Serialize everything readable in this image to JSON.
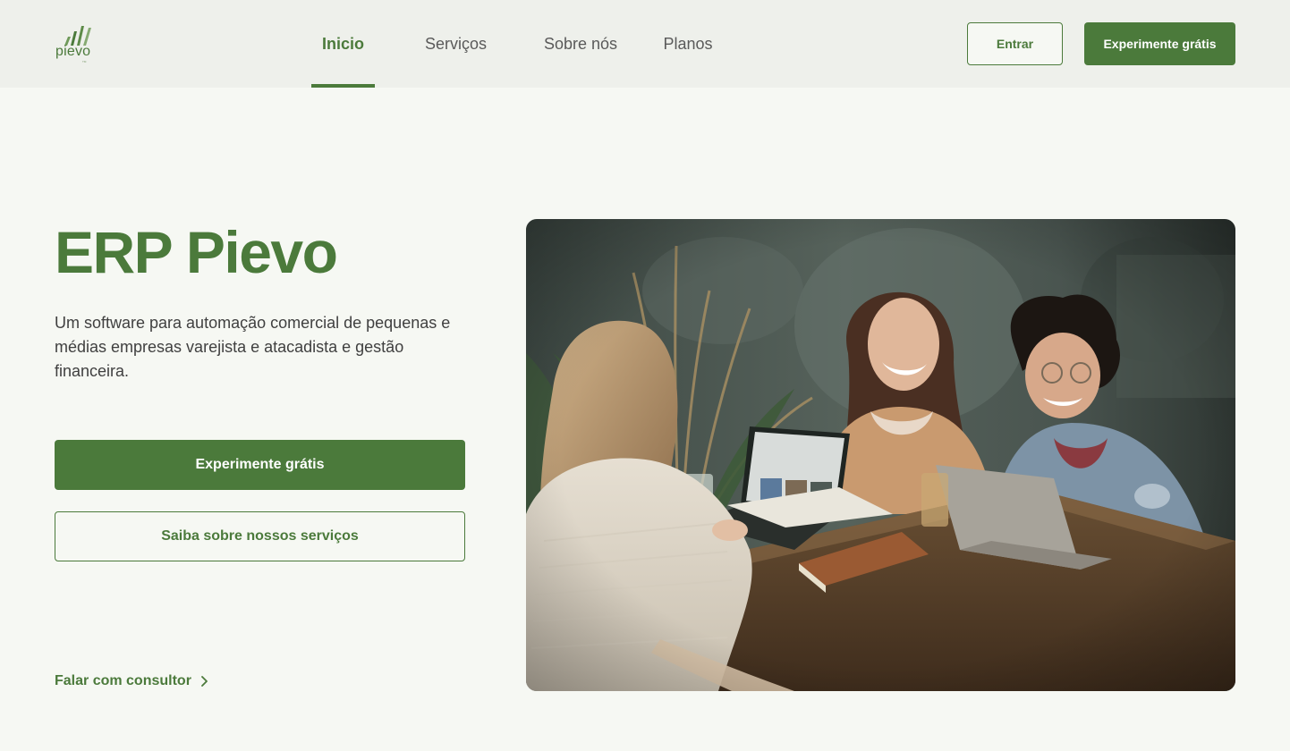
{
  "brand": {
    "name": "pievo",
    "trademark": "TM",
    "accent": "#4b7a3b"
  },
  "nav": {
    "items": [
      {
        "label": "Inicio",
        "active": true
      },
      {
        "label": "Serviços",
        "active": false
      },
      {
        "label": "Sobre nós",
        "active": false
      },
      {
        "label": "Planos",
        "active": false
      }
    ]
  },
  "header_actions": {
    "login_label": "Entrar",
    "try_label": "Experimente grátis"
  },
  "hero": {
    "title": "ERP Pievo",
    "description": "Um software para automação comercial de pequenas e médias empresas varejista e atacadista e gestão financeira.",
    "primary_cta": "Experimente grátis",
    "secondary_cta": "Saiba sobre nossos serviços",
    "consult_link": "Falar com consultor",
    "consult_icon": "chevron-right-icon",
    "image_description": "photo of three people laughing around a wooden table with laptops"
  },
  "colors": {
    "primary": "#4b7a3b",
    "background": "#f6f8f3",
    "header_bg": "#eef0eb"
  }
}
